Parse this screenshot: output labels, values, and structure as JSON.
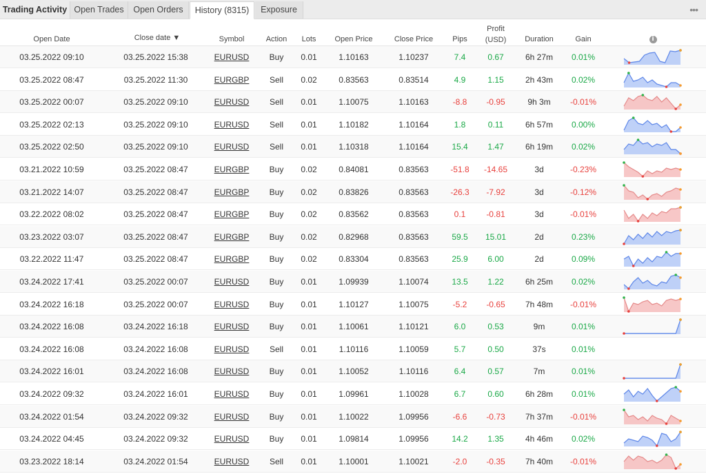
{
  "tabs": [
    {
      "label": "Trading Activity"
    },
    {
      "label": "Open Trades"
    },
    {
      "label": "Open Orders"
    },
    {
      "label": "History (8315)"
    },
    {
      "label": "Exposure"
    }
  ],
  "more_icon": "ellipsis-icon",
  "columns": {
    "open_date": "Open Date",
    "close_date": "Close date ▼",
    "symbol": "Symbol",
    "action": "Action",
    "lots": "Lots",
    "open_price": "Open Price",
    "close_price": "Close Price",
    "pips": "Pips",
    "profit_line1": "Profit",
    "profit_line2": "(USD)",
    "duration": "Duration",
    "gain": "Gain",
    "chart_icon": "info-icon"
  },
  "colors": {
    "positive": "#19a846",
    "negative": "#e8413d",
    "spark_blue": "#a9c1f5",
    "spark_red": "#f4b4b4"
  },
  "rows": [
    {
      "open": "03.25.2022 09:10",
      "close": "03.25.2022 15:38",
      "symbol": "EURUSD",
      "action": "Buy",
      "lots": "0.01",
      "open_price": "1.10163",
      "close_price": "1.10237",
      "pips": "7.4",
      "profit": "0.67",
      "duration": "6h 27m",
      "gain": "0.01%",
      "dir": "pos",
      "spark": [
        0.4,
        0.1,
        0.15,
        0.2,
        0.65,
        0.8,
        0.85,
        0.2,
        0.1,
        0.95,
        0.9,
        1.0
      ]
    },
    {
      "open": "03.25.2022 08:47",
      "close": "03.25.2022 11:30",
      "symbol": "EURGBP",
      "action": "Sell",
      "lots": "0.02",
      "open_price": "0.83563",
      "close_price": "0.83514",
      "pips": "4.9",
      "profit": "1.15",
      "duration": "2h 43m",
      "gain": "0.02%",
      "dir": "pos",
      "spark": [
        0.3,
        1.0,
        0.4,
        0.5,
        0.7,
        0.3,
        0.5,
        0.2,
        0.1,
        0.0,
        0.3,
        0.3,
        0.1
      ]
    },
    {
      "open": "03.25.2022 00:07",
      "close": "03.25.2022 09:10",
      "symbol": "EURUSD",
      "action": "Sell",
      "lots": "0.01",
      "open_price": "1.10075",
      "close_price": "1.10163",
      "pips": "-8.8",
      "profit": "-0.95",
      "duration": "9h 3m",
      "gain": "-0.01%",
      "dir": "neg",
      "spark": [
        0.2,
        0.8,
        0.6,
        0.9,
        1.0,
        0.7,
        0.6,
        0.9,
        0.5,
        0.8,
        0.4,
        0.0,
        0.3
      ]
    },
    {
      "open": "03.25.2022 02:13",
      "close": "03.25.2022 09:10",
      "symbol": "EURUSD",
      "action": "Sell",
      "lots": "0.01",
      "open_price": "1.10182",
      "close_price": "1.10164",
      "pips": "1.8",
      "profit": "0.11",
      "duration": "6h 57m",
      "gain": "0.00%",
      "dir": "pos",
      "spark": [
        0.1,
        0.8,
        1.0,
        0.6,
        0.5,
        0.8,
        0.5,
        0.6,
        0.3,
        0.5,
        0.0,
        0.0,
        0.3
      ]
    },
    {
      "open": "03.25.2022 02:50",
      "close": "03.25.2022 09:10",
      "symbol": "EURUSD",
      "action": "Sell",
      "lots": "0.01",
      "open_price": "1.10318",
      "close_price": "1.10164",
      "pips": "15.4",
      "profit": "1.47",
      "duration": "6h 19m",
      "gain": "0.02%",
      "dir": "pos",
      "spark": [
        0.3,
        0.7,
        0.6,
        1.0,
        0.7,
        0.8,
        0.5,
        0.7,
        0.6,
        0.8,
        0.3,
        0.3,
        0.0
      ]
    },
    {
      "open": "03.21.2022 10:59",
      "close": "03.25.2022 08:47",
      "symbol": "EURGBP",
      "action": "Buy",
      "lots": "0.02",
      "open_price": "0.84081",
      "close_price": "0.83563",
      "pips": "-51.8",
      "profit": "-14.65",
      "duration": "3d",
      "gain": "-0.23%",
      "dir": "neg",
      "spark": [
        1.0,
        0.7,
        0.5,
        0.3,
        0.0,
        0.4,
        0.2,
        0.4,
        0.3,
        0.6,
        0.5,
        0.6,
        0.5
      ]
    },
    {
      "open": "03.21.2022 14:07",
      "close": "03.25.2022 08:47",
      "symbol": "EURGBP",
      "action": "Buy",
      "lots": "0.02",
      "open_price": "0.83826",
      "close_price": "0.83563",
      "pips": "-26.3",
      "profit": "-7.92",
      "duration": "3d",
      "gain": "-0.12%",
      "dir": "neg",
      "spark": [
        1.0,
        0.6,
        0.5,
        0.1,
        0.3,
        0.0,
        0.3,
        0.4,
        0.2,
        0.5,
        0.6,
        0.8,
        0.7
      ]
    },
    {
      "open": "03.22.2022 08:02",
      "close": "03.25.2022 08:47",
      "symbol": "EURGBP",
      "action": "Buy",
      "lots": "0.02",
      "open_price": "0.83562",
      "close_price": "0.83563",
      "pips": "0.1",
      "profit": "-0.81",
      "duration": "3d",
      "gain": "-0.01%",
      "dir": "neg",
      "spark": [
        0.8,
        0.2,
        0.5,
        0.0,
        0.5,
        0.2,
        0.6,
        0.4,
        0.7,
        0.6,
        0.9,
        0.9,
        1.0
      ]
    },
    {
      "open": "03.23.2022 03:07",
      "close": "03.25.2022 08:47",
      "symbol": "EURGBP",
      "action": "Buy",
      "lots": "0.02",
      "open_price": "0.82968",
      "close_price": "0.83563",
      "pips": "59.5",
      "profit": "15.01",
      "duration": "2d",
      "gain": "0.23%",
      "dir": "pos",
      "spark": [
        0.0,
        0.6,
        0.3,
        0.7,
        0.4,
        0.8,
        0.5,
        0.9,
        0.6,
        0.9,
        0.8,
        0.95,
        1.0
      ]
    },
    {
      "open": "03.22.2022 11:47",
      "close": "03.25.2022 08:47",
      "symbol": "EURGBP",
      "action": "Buy",
      "lots": "0.02",
      "open_price": "0.83304",
      "close_price": "0.83563",
      "pips": "25.9",
      "profit": "6.00",
      "duration": "2d",
      "gain": "0.09%",
      "dir": "pos",
      "spark": [
        0.5,
        0.7,
        0.0,
        0.5,
        0.2,
        0.6,
        0.3,
        0.7,
        0.6,
        1.0,
        0.7,
        0.9,
        0.9
      ]
    },
    {
      "open": "03.24.2022 17:41",
      "close": "03.25.2022 00:07",
      "symbol": "EURUSD",
      "action": "Buy",
      "lots": "0.01",
      "open_price": "1.09939",
      "close_price": "1.10074",
      "pips": "13.5",
      "profit": "1.22",
      "duration": "6h 25m",
      "gain": "0.02%",
      "dir": "pos",
      "spark": [
        0.3,
        0.0,
        0.5,
        0.8,
        0.4,
        0.6,
        0.3,
        0.2,
        0.5,
        0.4,
        0.9,
        1.0,
        0.8
      ]
    },
    {
      "open": "03.24.2022 16:18",
      "close": "03.25.2022 00:07",
      "symbol": "EURUSD",
      "action": "Buy",
      "lots": "0.01",
      "open_price": "1.10127",
      "close_price": "1.10075",
      "pips": "-5.2",
      "profit": "-0.65",
      "duration": "7h 48m",
      "gain": "-0.01%",
      "dir": "neg",
      "spark": [
        1.0,
        0.0,
        0.6,
        0.5,
        0.7,
        0.8,
        0.5,
        0.6,
        0.4,
        0.8,
        0.9,
        0.8,
        0.9
      ]
    },
    {
      "open": "03.24.2022 16:08",
      "close": "03.24.2022 16:18",
      "symbol": "EURUSD",
      "action": "Buy",
      "lots": "0.01",
      "open_price": "1.10061",
      "close_price": "1.10121",
      "pips": "6.0",
      "profit": "0.53",
      "duration": "9m",
      "gain": "0.01%",
      "dir": "pos",
      "spark": [
        0.0,
        0.0,
        0.0,
        0.0,
        0.0,
        0.0,
        0.0,
        0.0,
        0.0,
        0.0,
        0.0,
        0.0,
        1.0
      ]
    },
    {
      "open": "03.24.2022 16:08",
      "close": "03.24.2022 16:08",
      "symbol": "EURUSD",
      "action": "Sell",
      "lots": "0.01",
      "open_price": "1.10116",
      "close_price": "1.10059",
      "pips": "5.7",
      "profit": "0.50",
      "duration": "37s",
      "gain": "0.01%",
      "dir": "pos",
      "spark": []
    },
    {
      "open": "03.24.2022 16:01",
      "close": "03.24.2022 16:08",
      "symbol": "EURUSD",
      "action": "Buy",
      "lots": "0.01",
      "open_price": "1.10052",
      "close_price": "1.10116",
      "pips": "6.4",
      "profit": "0.57",
      "duration": "7m",
      "gain": "0.01%",
      "dir": "pos",
      "spark": [
        0.0,
        0.0,
        0.0,
        0.0,
        0.0,
        0.0,
        0.0,
        0.0,
        0.0,
        0.0,
        0.0,
        0.0,
        1.0
      ]
    },
    {
      "open": "03.24.2022 09:32",
      "close": "03.24.2022 16:01",
      "symbol": "EURUSD",
      "action": "Buy",
      "lots": "0.01",
      "open_price": "1.09961",
      "close_price": "1.10028",
      "pips": "6.7",
      "profit": "0.60",
      "duration": "6h 28m",
      "gain": "0.01%",
      "dir": "pos",
      "spark": [
        0.5,
        0.8,
        0.3,
        0.7,
        0.5,
        0.9,
        0.4,
        0.0,
        0.3,
        0.6,
        0.9,
        1.0,
        0.7
      ]
    },
    {
      "open": "03.24.2022 01:54",
      "close": "03.24.2022 09:32",
      "symbol": "EURUSD",
      "action": "Buy",
      "lots": "0.01",
      "open_price": "1.10022",
      "close_price": "1.09956",
      "pips": "-6.6",
      "profit": "-0.73",
      "duration": "7h 37m",
      "gain": "-0.01%",
      "dir": "neg",
      "spark": [
        1.0,
        0.5,
        0.6,
        0.3,
        0.5,
        0.2,
        0.6,
        0.4,
        0.3,
        0.0,
        0.6,
        0.4,
        0.2
      ]
    },
    {
      "open": "03.24.2022 04:45",
      "close": "03.24.2022 09:32",
      "symbol": "EURUSD",
      "action": "Buy",
      "lots": "0.01",
      "open_price": "1.09814",
      "close_price": "1.09956",
      "pips": "14.2",
      "profit": "1.35",
      "duration": "4h 46m",
      "gain": "0.02%",
      "dir": "pos",
      "spark": [
        0.2,
        0.5,
        0.4,
        0.3,
        0.7,
        0.6,
        0.4,
        0.0,
        0.9,
        0.8,
        0.3,
        0.5,
        1.0
      ]
    },
    {
      "open": "03.23.2022 18:14",
      "close": "03.24.2022 01:54",
      "symbol": "EURUSD",
      "action": "Sell",
      "lots": "0.01",
      "open_price": "1.10001",
      "close_price": "1.10021",
      "pips": "-2.0",
      "profit": "-0.35",
      "duration": "7h 40m",
      "gain": "-0.01%",
      "dir": "neg",
      "spark": [
        0.5,
        0.9,
        0.6,
        0.9,
        0.8,
        0.5,
        0.6,
        0.4,
        0.6,
        1.0,
        0.8,
        0.0,
        0.3
      ]
    }
  ]
}
